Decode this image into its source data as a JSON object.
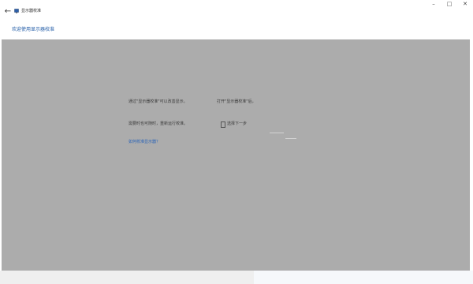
{
  "window": {
    "title": "显示器校准",
    "controls": {
      "minimize": "–",
      "maximize": "□",
      "close": "✕"
    },
    "back_glyph": "←",
    "app_icon": "display-calibration-icon"
  },
  "header": {
    "subtitle_link": "欢迎使用显示器校准"
  },
  "panel": {
    "left_line1": "通过\"显示器校准\"可以改善显示。",
    "left_line2": "需要时也可随时，重新运行校准。",
    "left_link": "如何校准显示器？",
    "right_line1": "打开\"显示器校准\"后，",
    "right_line2": "选择下一步"
  },
  "colors": {
    "panel_bg": "#acacac",
    "link": "#1f5aa6"
  }
}
